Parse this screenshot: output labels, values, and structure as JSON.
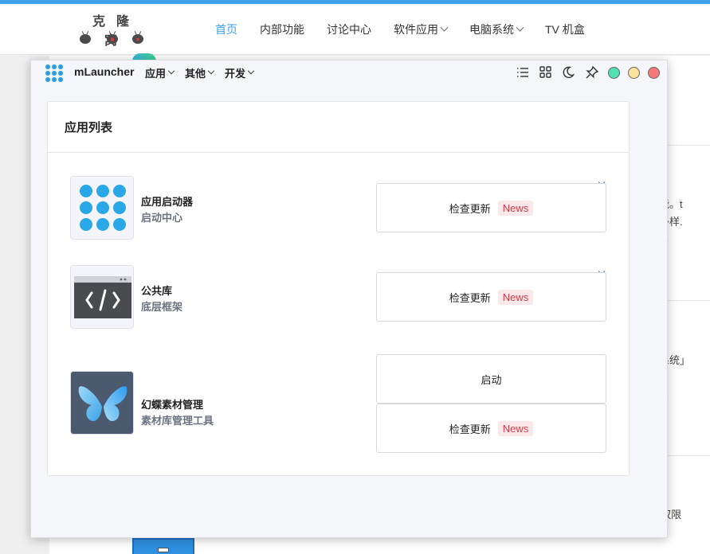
{
  "site": {
    "logo_text": "克隆窝",
    "nav": [
      {
        "label": "首页"
      },
      {
        "label": "内部功能"
      },
      {
        "label": "讨论中心"
      },
      {
        "label": "软件应用"
      },
      {
        "label": "电脑系统"
      },
      {
        "label": "TV 机盒"
      }
    ],
    "peek": [
      "漏功能。t",
      "是供多样.",
      "操作系统」",
      "OOT权限"
    ],
    "colors": {
      "accent": "#3da2e8"
    }
  },
  "launcher": {
    "brand": "mLauncher",
    "menus": [
      {
        "label": "应用"
      },
      {
        "label": "其他"
      },
      {
        "label": "开发"
      }
    ],
    "toolbar_icons": [
      "list-icon",
      "grid-icon",
      "moon-icon",
      "pin-icon"
    ],
    "window_dots": {
      "green": "#53e0b0",
      "yellow": "#fbe39c",
      "red": "#f47a7a"
    },
    "card_title": "应用列表",
    "apps": [
      {
        "name": "应用启动器",
        "desc": "启动中心",
        "icon": "launcher-icon",
        "actions": [
          {
            "label": "检查更新",
            "badge": "News"
          }
        ]
      },
      {
        "name": "公共库",
        "desc": "底层框架",
        "icon": "code-window-icon",
        "actions": [
          {
            "label": "检查更新",
            "badge": "News"
          }
        ]
      },
      {
        "name": "幻蝶素材管理",
        "desc": "素材库管理工具",
        "icon": "butterfly-icon",
        "actions": [
          {
            "label": "启动",
            "badge": ""
          },
          {
            "label": "检查更新",
            "badge": "News"
          }
        ]
      }
    ]
  }
}
